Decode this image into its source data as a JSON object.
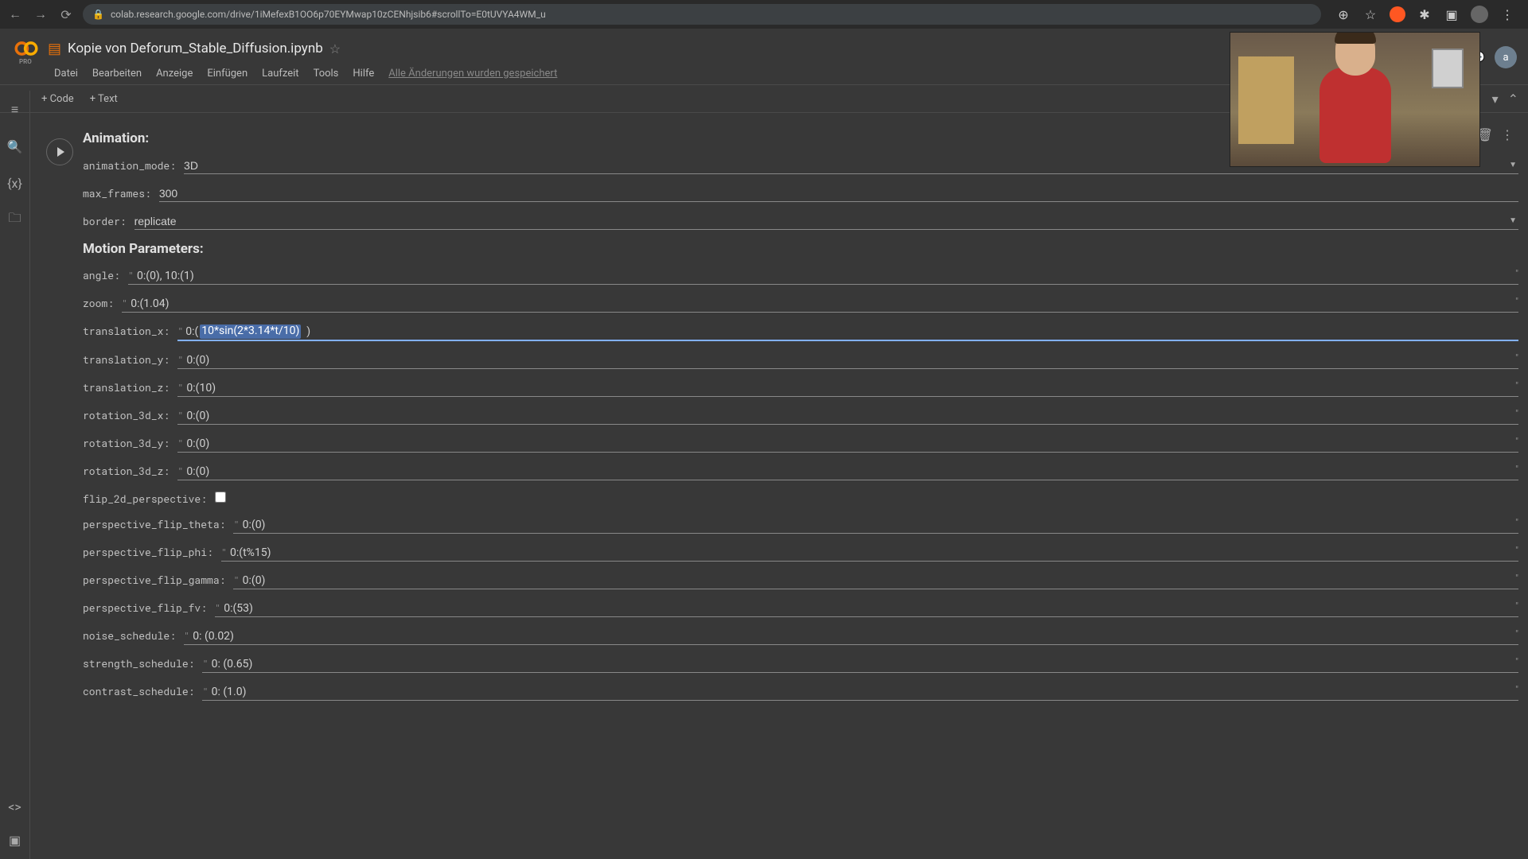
{
  "browser": {
    "url": "colab.research.google.com/drive/1iMefexB1OO6p70EYMwap10zCENhjsib6#scrollTo=E0tUVYA4WM_u"
  },
  "header": {
    "title": "Kopie von Deforum_Stable_Diffusion.ipynb",
    "avatar_letter": "a",
    "pro_label": "PRO"
  },
  "menu": {
    "items": [
      "Datei",
      "Bearbeiten",
      "Anzeige",
      "Einfügen",
      "Laufzeit",
      "Tools",
      "Hilfe"
    ],
    "status": "Alle Änderungen wurden gespeichert"
  },
  "toolbar": {
    "code_btn": "+ Code",
    "text_btn": "+ Text"
  },
  "form": {
    "section_animation": "Animation:",
    "section_motion": "Motion Parameters:",
    "fields": {
      "animation_mode": {
        "label": "animation_mode:",
        "value": "3D"
      },
      "max_frames": {
        "label": "max_frames:",
        "value": "300"
      },
      "border": {
        "label": "border:",
        "value": "replicate"
      },
      "angle": {
        "label": "angle:",
        "value": "0:(0), 10:(1)"
      },
      "zoom": {
        "label": "zoom:",
        "value": "0:(1.04)"
      },
      "translation_x": {
        "label": "translation_x:",
        "value": "0:(10*sin(2*3.14*t/10))",
        "selected_part": "10*sin(2*3.14*t/10)"
      },
      "translation_y": {
        "label": "translation_y:",
        "value": "0:(0)"
      },
      "translation_z": {
        "label": "translation_z:",
        "value": "0:(10)"
      },
      "rotation_3d_x": {
        "label": "rotation_3d_x:",
        "value": "0:(0)"
      },
      "rotation_3d_y": {
        "label": "rotation_3d_y:",
        "value": "0:(0)"
      },
      "rotation_3d_z": {
        "label": "rotation_3d_z:",
        "value": "0:(0)"
      },
      "flip_2d_perspective": {
        "label": "flip_2d_perspective:"
      },
      "perspective_flip_theta": {
        "label": "perspective_flip_theta:",
        "value": "0:(0)"
      },
      "perspective_flip_phi": {
        "label": "perspective_flip_phi:",
        "value": "0:(t%15)"
      },
      "perspective_flip_gamma": {
        "label": "perspective_flip_gamma:",
        "value": "0:(0)"
      },
      "perspective_flip_fv": {
        "label": "perspective_flip_fv:",
        "value": "0:(53)"
      },
      "noise_schedule": {
        "label": "noise_schedule:",
        "value": "0: (0.02)"
      },
      "strength_schedule": {
        "label": "strength_schedule:",
        "value": "0: (0.65)"
      },
      "contrast_schedule": {
        "label": "contrast_schedule:",
        "value": "0: (1.0)"
      }
    }
  }
}
